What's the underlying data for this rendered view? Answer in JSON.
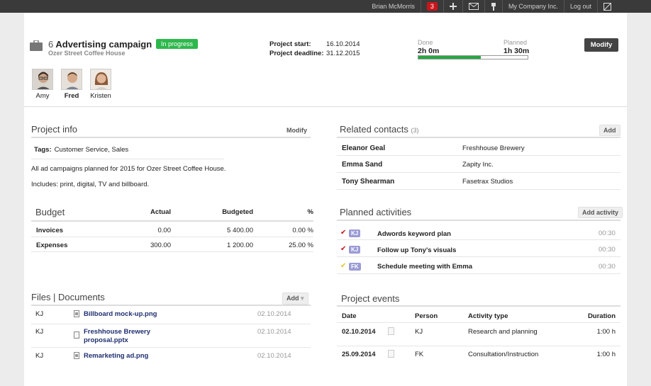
{
  "topbar": {
    "user": "Brian McMorris",
    "notifications": "3",
    "company": "My Company Inc.",
    "logout": "Log out"
  },
  "project": {
    "number": "6",
    "title": "Advertising campaign",
    "client": "Ozer Street Coffee House",
    "status": "In progress",
    "start_label": "Project start:",
    "start": "16.10.2014",
    "deadline_label": "Project deadline:",
    "deadline": "31.12.2015",
    "done_label": "Done",
    "done_value": "2h 0m",
    "planned_label": "Planned",
    "planned_value": "1h 30m",
    "progress_fraction": 0.57,
    "modify_label": "Modify"
  },
  "members": [
    {
      "name": "Amy",
      "bold": false
    },
    {
      "name": "Fred",
      "bold": true
    },
    {
      "name": "Kristen",
      "bold": false
    }
  ],
  "project_info": {
    "title": "Project info",
    "modify": "Modify",
    "tags_label": "Tags:",
    "tags": "Customer Service, Sales",
    "description": [
      "All ad campaigns planned for 2015 for Ozer Street Coffee House.",
      "Includes: print, digital, TV and billboard."
    ]
  },
  "budget": {
    "title": "Budget",
    "columns": [
      "Actual",
      "Budgeted",
      "%"
    ],
    "rows": [
      {
        "label": "Invoices",
        "actual": "0.00",
        "budgeted": "5 400.00",
        "pct": "0.00 %"
      },
      {
        "label": "Expenses",
        "actual": "300.00",
        "budgeted": "1 200.00",
        "pct": "25.00 %"
      }
    ]
  },
  "files": {
    "title": "Files | Documents",
    "add": "Add",
    "rows": [
      {
        "owner": "KJ",
        "name": "Billboard mock-up.png",
        "date": "02.10.2014"
      },
      {
        "owner": "KJ",
        "name": "Freshhouse Brewery proposal.pptx",
        "date": "02.10.2014"
      },
      {
        "owner": "KJ",
        "name": "Remarketing ad.png",
        "date": "02.10.2014"
      }
    ]
  },
  "contacts": {
    "title": "Related contacts",
    "count": "(3)",
    "add": "Add",
    "rows": [
      {
        "name": "Eleanor Geal",
        "company": "Freshhouse Brewery"
      },
      {
        "name": "Emma Sand",
        "company": "Zapity Inc."
      },
      {
        "name": "Tony Shearman",
        "company": "Fasetrax Studios"
      }
    ]
  },
  "activities": {
    "title": "Planned activities",
    "add": "Add activity",
    "rows": [
      {
        "initials": "KJ",
        "title": "Adwords keyword plan",
        "time": "00:30",
        "check_color": "#c8161d"
      },
      {
        "initials": "KJ",
        "title": "Follow up Tony's visuals",
        "time": "00:30",
        "check_color": "#c8161d"
      },
      {
        "initials": "FK",
        "title": "Schedule meeting with Emma",
        "time": "00:30",
        "check_color": "#e8c51a"
      }
    ]
  },
  "events": {
    "title": "Project events",
    "columns": [
      "Date",
      "Person",
      "Activity type",
      "Duration"
    ],
    "rows": [
      {
        "date": "02.10.2014",
        "person": "KJ",
        "type": "Research and planning",
        "duration": "1:00 h"
      },
      {
        "date": "25.09.2014",
        "person": "FK",
        "type": "Consultation/Instruction",
        "duration": "1:00 h"
      }
    ]
  }
}
